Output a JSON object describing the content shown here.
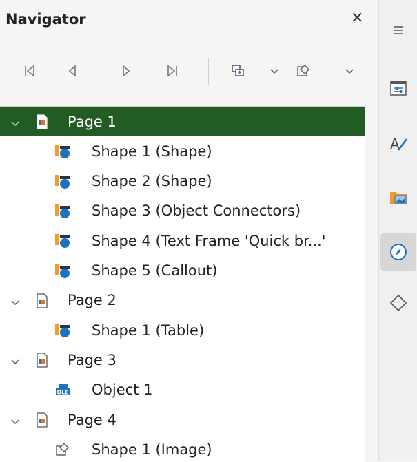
{
  "navigator": {
    "title": "Navigator",
    "close_icon": "close-icon"
  },
  "toolbar": {
    "buttons": [
      "first-icon",
      "previous-icon",
      "next-icon",
      "last-icon",
      "drag-mode-icon",
      "chevron-down-icon",
      "shapes-icon",
      "chevron-down-icon"
    ]
  },
  "tree": {
    "selected_color": "#235b25",
    "rows": [
      {
        "label": "Page 1",
        "type": "page",
        "expanded": true,
        "selected": true
      },
      {
        "label": "Shape 1 (Shape)",
        "type": "shape"
      },
      {
        "label": "Shape 2 (Shape)",
        "type": "shape"
      },
      {
        "label": "Shape 3 (Object Connectors)",
        "type": "shape"
      },
      {
        "label": "Shape 4 (Text Frame 'Quick br...'",
        "type": "shape"
      },
      {
        "label": "Shape 5 (Callout)",
        "type": "shape"
      },
      {
        "label": "Page 2",
        "type": "page",
        "expanded": true
      },
      {
        "label": "Shape 1 (Table)",
        "type": "shape"
      },
      {
        "label": "Page 3",
        "type": "page",
        "expanded": true
      },
      {
        "label": "Object 1",
        "type": "ole"
      },
      {
        "label": "Page 4",
        "type": "page",
        "expanded": true
      },
      {
        "label": "Shape 1 (Image)",
        "type": "image"
      }
    ]
  },
  "sidebar": {
    "items": [
      "menu-icon",
      "properties-icon",
      "styles-icon",
      "gallery-icon",
      "navigator-icon",
      "shapes-icon"
    ],
    "active": "navigator-icon"
  }
}
